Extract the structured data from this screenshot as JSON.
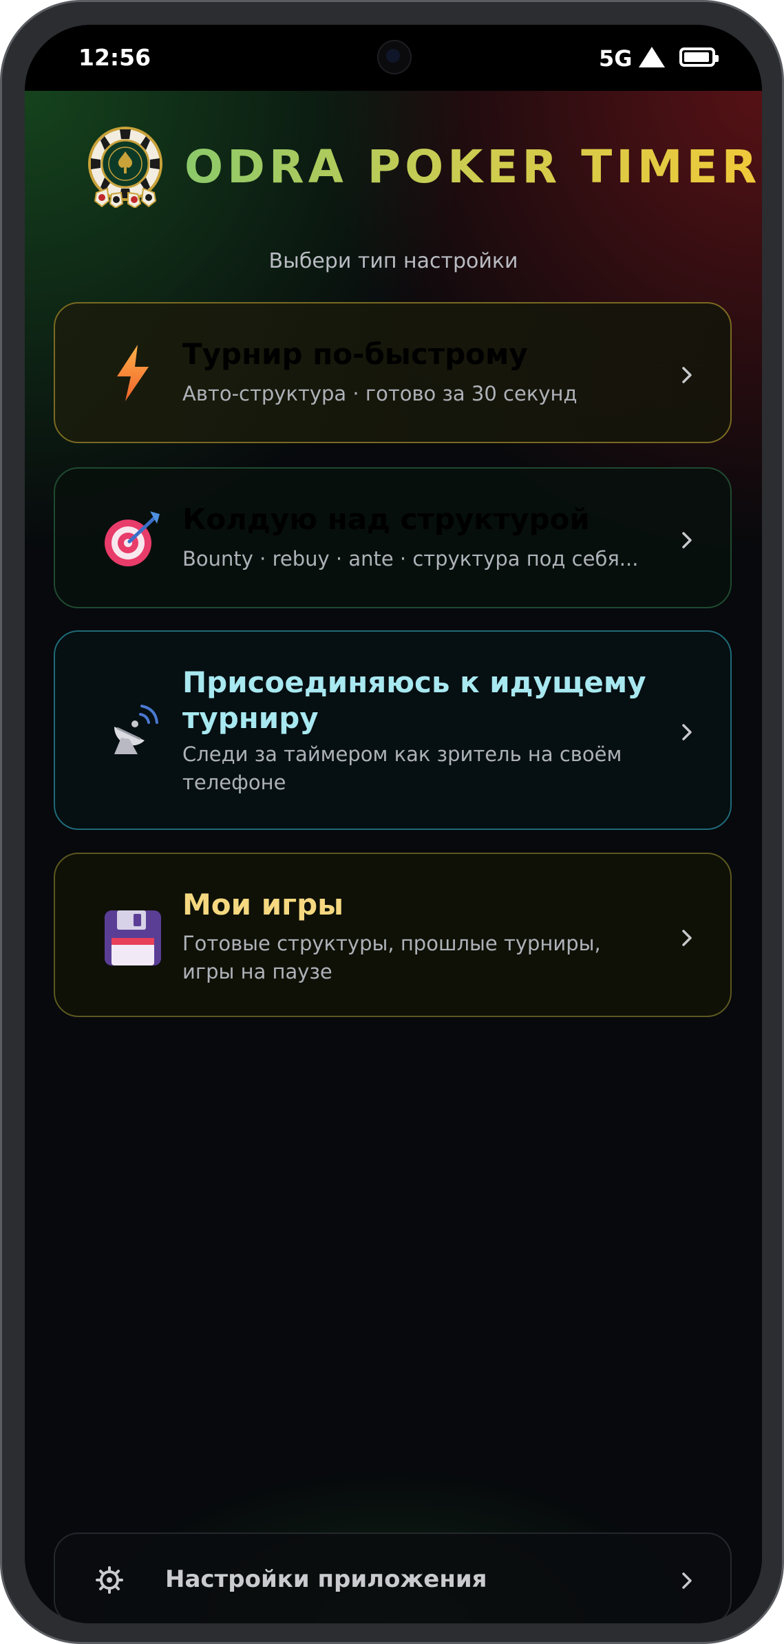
{
  "status_bar": {
    "time": "12:56",
    "network": "5G"
  },
  "header": {
    "app_title": "ODRA POKER TIMER",
    "subtitle": "Выбери тип настройки"
  },
  "menu": [
    {
      "title": "Турнир по-быстрому",
      "description": "Авто-структура · готово за 30 секунд",
      "icon": "lightning-icon",
      "title_color": "#ffffff"
    },
    {
      "title": "Колдую над структурой",
      "description": "Bounty · rebuy · ante · структура под себя...",
      "icon": "target-icon",
      "title_color": "#ffffff"
    },
    {
      "title": "Присоединяюсь к идущему турниру",
      "description": "Следи за таймером как зритель на своём телефоне",
      "icon": "satellite-dish-icon",
      "title_color": "#a8e8f0"
    },
    {
      "title": "Мои игры",
      "description": "Готовые структуры, прошлые турниры, игры на паузе",
      "icon": "floppy-disk-icon",
      "title_color": "#f5d880"
    }
  ],
  "settings": {
    "label": "Настройки приложения",
    "icon": "gear-icon"
  }
}
